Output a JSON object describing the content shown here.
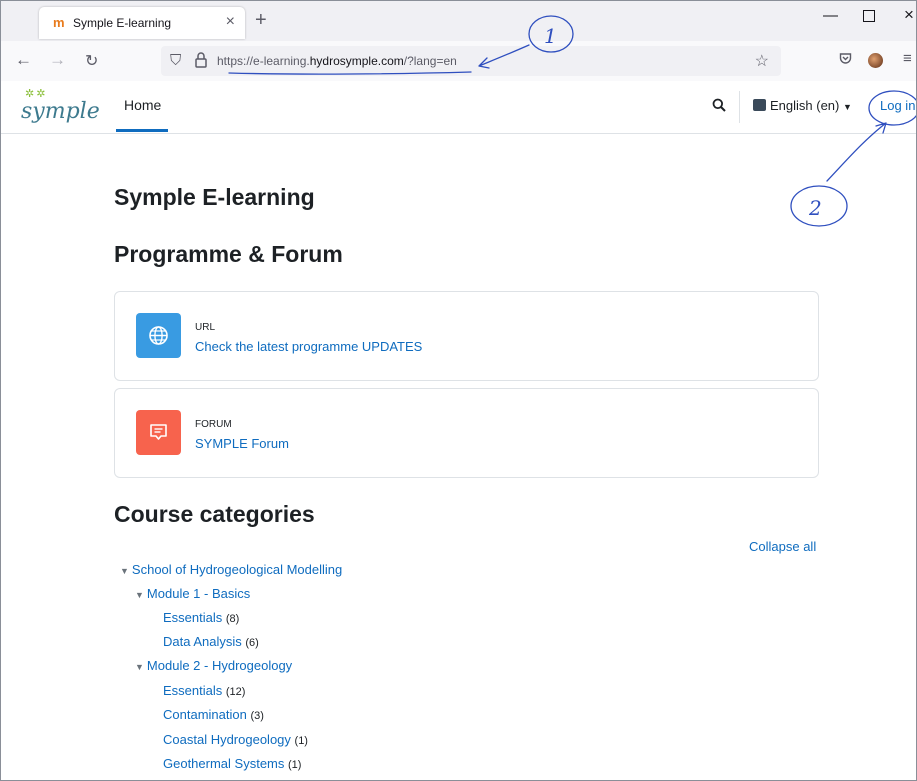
{
  "browser": {
    "tab_title": "Symple E-learning",
    "tab_favicon": "moodle-favicon",
    "url_prefix": "https://e-learning.",
    "url_domain": "hydrosymple.com",
    "url_suffix": "/?lang=en"
  },
  "header": {
    "logo_text": "symple",
    "nav_home": "Home",
    "language": "English (en)",
    "login": "Log in"
  },
  "main": {
    "site_title": "Symple E-learning",
    "section_title": "Programme & Forum",
    "activities": [
      {
        "type": "URL",
        "label": "Check the latest programme UPDATES",
        "icon": "globe-icon",
        "color": "#399be2"
      },
      {
        "type": "FORUM",
        "label": "SYMPLE Forum",
        "icon": "forum-icon",
        "color": "#f7634d"
      }
    ],
    "categories_title": "Course categories",
    "collapse_all": "Collapse all",
    "categories": [
      {
        "label": "School of Hydrogeological Modelling",
        "count": "",
        "expanded": true
      },
      {
        "label": "Module 1 - Basics",
        "count": "",
        "expanded": true
      },
      {
        "label": "Essentials",
        "count": "(8)"
      },
      {
        "label": "Data Analysis",
        "count": "(6)"
      },
      {
        "label": "Module 2 - Hydrogeology",
        "count": "",
        "expanded": true
      },
      {
        "label": "Essentials",
        "count": "(12)"
      },
      {
        "label": "Contamination",
        "count": "(3)"
      },
      {
        "label": "Coastal Hydrogeology",
        "count": "(1)"
      },
      {
        "label": "Geothermal Systems",
        "count": "(1)"
      }
    ]
  },
  "annotations": {
    "mark_1": "1",
    "mark_2": "2",
    "pen_color": "#2f4fbf"
  }
}
